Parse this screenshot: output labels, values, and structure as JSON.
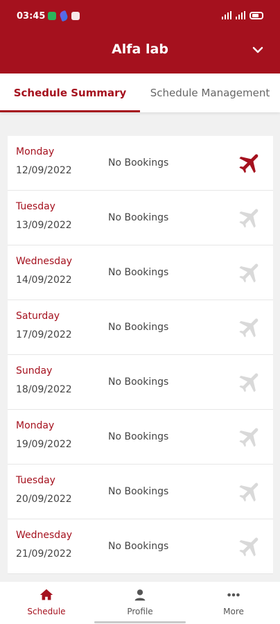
{
  "status_bar": {
    "time": "03:45"
  },
  "header": {
    "title": "Alfa lab"
  },
  "tabs": [
    {
      "label": "Schedule Summary"
    },
    {
      "label": "Schedule Management"
    }
  ],
  "schedule": [
    {
      "day": "Monday",
      "date": "12/09/2022",
      "status": "No Bookings",
      "icon": "airplane-icon"
    },
    {
      "day": "Tuesday",
      "date": "13/09/2022",
      "status": "No Bookings",
      "icon": "airplane-icon"
    },
    {
      "day": "Wednesday",
      "date": "14/09/2022",
      "status": "No Bookings",
      "icon": "airplane-icon"
    },
    {
      "day": "Saturday",
      "date": "17/09/2022",
      "status": "No Bookings",
      "icon": "airplane-icon"
    },
    {
      "day": "Sunday",
      "date": "18/09/2022",
      "status": "No Bookings",
      "icon": "airplane-icon"
    },
    {
      "day": "Monday",
      "date": "19/09/2022",
      "status": "No Bookings",
      "icon": "airplane-icon"
    },
    {
      "day": "Tuesday",
      "date": "20/09/2022",
      "status": "No Bookings",
      "icon": "airplane-icon"
    },
    {
      "day": "Wednesday",
      "date": "21/09/2022",
      "status": "No Bookings",
      "icon": "airplane-icon"
    }
  ],
  "bottom_nav": [
    {
      "label": "Schedule",
      "icon": "home-icon"
    },
    {
      "label": "Profile",
      "icon": "person-icon"
    },
    {
      "label": "More",
      "icon": "more-icon"
    }
  ],
  "colors": {
    "primary": "#a5111e",
    "plane_inactive": "#d9d9d9"
  }
}
